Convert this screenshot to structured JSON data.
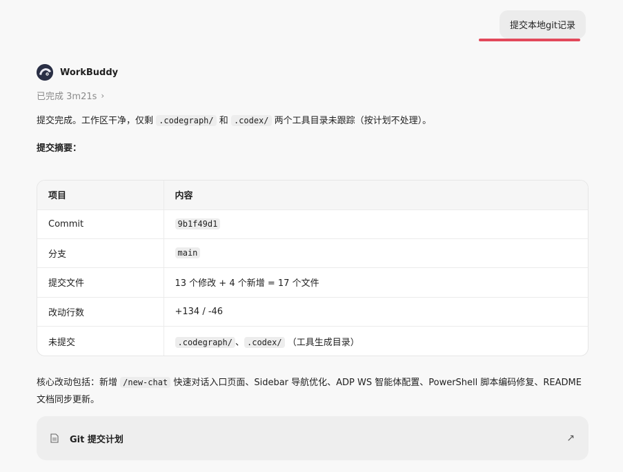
{
  "user_message": "提交本地git记录",
  "assistant": {
    "name": "WorkBuddy",
    "status": "已完成 3m21s"
  },
  "intro": {
    "p1": "提交完成。工作区干净，仅剩",
    "c1": ".codegraph/",
    "p2": "和",
    "c2": ".codex/",
    "p3": "两个工具目录未跟踪（按计划不处理）。"
  },
  "summary_title": "提交摘要：",
  "table": {
    "headers": [
      "项目",
      "内容"
    ],
    "rows": [
      {
        "key": "Commit",
        "value_code": "9b1f49d1"
      },
      {
        "key": "分支",
        "value_code": "main"
      },
      {
        "key": "提交文件",
        "value": "13 个修改 + 4 个新增 = 17 个文件"
      },
      {
        "key": "改动行数",
        "value": "+134 / -46"
      },
      {
        "key": "未提交",
        "code1": ".codegraph/",
        "sep": "、",
        "code2": ".codex/",
        "tail": "（工具生成目录）"
      }
    ]
  },
  "core": {
    "p1": "核心改动包括：新增",
    "c1": "/new-chat",
    "p2": "快速对话入口页面、Sidebar 导航优化、ADP WS 智能体配置、PowerShell 脚本编码修复、README 文档同步更新。"
  },
  "plan_card": {
    "label": "Git 提交计划",
    "icon": "document-icon",
    "arrow_icon": "arrow-up-right-icon"
  }
}
